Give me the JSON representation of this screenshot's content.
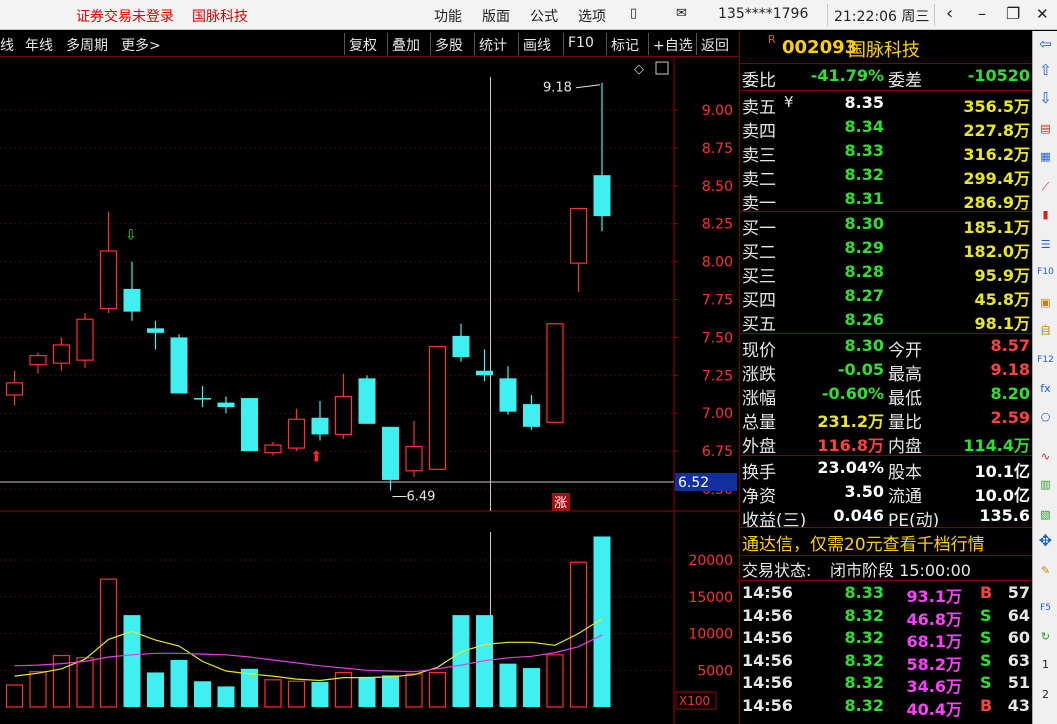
{
  "titlebar": {
    "login_status": "证券交易未登录",
    "stock_name": "国脉科技",
    "menu": [
      "功能",
      "版面",
      "公式",
      "选项"
    ],
    "account": "135****1796",
    "clock": "21:22:06 周三",
    "back_icon": "‹",
    "minimize_icon": "–",
    "restore_icon": "❐",
    "close_icon": "✕"
  },
  "toolbar": {
    "left_items": [
      "线",
      "年线",
      "多周期",
      "更多>"
    ],
    "buttons": [
      "复权",
      "叠加",
      "多股",
      "统计",
      "画线",
      "F10",
      "标记",
      "+自选",
      "返回"
    ]
  },
  "stock": {
    "marker": "R",
    "code": "002093",
    "name": "国脉科技"
  },
  "quote": {
    "weibi_label": "委比",
    "weibi_value": "-41.79%",
    "weicha_label": "委差",
    "weicha_value": "-10520",
    "asks": [
      {
        "label": "卖五",
        "flag": "¥",
        "price": "8.35",
        "volume": "356.5万"
      },
      {
        "label": "卖四",
        "flag": "",
        "price": "8.34",
        "volume": "227.8万"
      },
      {
        "label": "卖三",
        "flag": "",
        "price": "8.33",
        "volume": "316.2万"
      },
      {
        "label": "卖二",
        "flag": "",
        "price": "8.32",
        "volume": "299.4万"
      },
      {
        "label": "卖一",
        "flag": "",
        "price": "8.31",
        "volume": "286.9万"
      }
    ],
    "bids": [
      {
        "label": "买一",
        "price": "8.30",
        "volume": "185.1万"
      },
      {
        "label": "买二",
        "price": "8.29",
        "volume": "182.0万"
      },
      {
        "label": "买三",
        "price": "8.28",
        "volume": "95.9万"
      },
      {
        "label": "买四",
        "price": "8.27",
        "volume": "45.8万"
      },
      {
        "label": "买五",
        "price": "8.26",
        "volume": "98.1万"
      }
    ],
    "stats": [
      {
        "l1": "现价",
        "v1": "8.30",
        "c1": "green",
        "l2": "今开",
        "v2": "8.57",
        "c2": "red"
      },
      {
        "l1": "涨跌",
        "v1": "-0.05",
        "c1": "green",
        "l2": "最高",
        "v2": "9.18",
        "c2": "red"
      },
      {
        "l1": "涨幅",
        "v1": "-0.60%",
        "c1": "green",
        "l2": "最低",
        "v2": "8.20",
        "c2": "green"
      },
      {
        "l1": "总量",
        "v1": "231.2万",
        "c1": "yellow",
        "l2": "量比",
        "v2": "2.59",
        "c2": "red"
      },
      {
        "l1": "外盘",
        "v1": "116.8万",
        "c1": "red",
        "l2": "内盘",
        "v2": "114.4万",
        "c2": "green"
      }
    ],
    "stats2": [
      {
        "l1": "换手",
        "v1": "23.04%",
        "l2": "股本",
        "v2": "10.1亿"
      },
      {
        "l1": "净资",
        "v1": "3.50",
        "l2": "流通",
        "v2": "10.0亿"
      },
      {
        "l1": "收益(三)",
        "v1": "0.046",
        "l2": "PE(动)",
        "v2": "135.6"
      }
    ],
    "ad_text": "通达信，仅需20元查看千档行情",
    "status_label": "交易状态:",
    "status_value": "闭市阶段 15:00:00",
    "ticks": [
      {
        "time": "14:56",
        "price": "8.33",
        "vol": "93.1万",
        "bs": "B",
        "n": "57"
      },
      {
        "time": "14:56",
        "price": "8.32",
        "vol": "46.8万",
        "bs": "S",
        "n": "64"
      },
      {
        "time": "14:56",
        "price": "8.32",
        "vol": "68.1万",
        "bs": "S",
        "n": "60"
      },
      {
        "time": "14:56",
        "price": "8.32",
        "vol": "58.2万",
        "bs": "S",
        "n": "63"
      },
      {
        "time": "14:56",
        "price": "8.32",
        "vol": "34.6万",
        "bs": "S",
        "n": "51"
      },
      {
        "time": "14:56",
        "price": "8.32",
        "vol": "40.4万",
        "bs": "B",
        "n": "43"
      }
    ]
  },
  "chart_data": {
    "type": "candlestick",
    "price_ticks": [
      "9.00",
      "8.75",
      "8.50",
      "8.25",
      "8.00",
      "7.75",
      "7.50",
      "7.25",
      "7.00",
      "6.75",
      "6.50"
    ],
    "volume_ticks": [
      "20000",
      "15000",
      "10000",
      "5000"
    ],
    "volume_unit": "X100",
    "high_label": "9.18",
    "low_label": "6.49",
    "cursor_price": "6.52",
    "limit_up_marker": "涨",
    "candles": [
      {
        "o": 7.12,
        "c": 7.2,
        "h": 7.28,
        "l": 7.05
      },
      {
        "o": 7.32,
        "c": 7.38,
        "h": 7.4,
        "l": 7.26
      },
      {
        "o": 7.33,
        "c": 7.45,
        "h": 7.5,
        "l": 7.28
      },
      {
        "o": 7.35,
        "c": 7.62,
        "h": 7.66,
        "l": 7.3
      },
      {
        "o": 7.69,
        "c": 8.07,
        "h": 8.33,
        "l": 7.66
      },
      {
        "o": 7.82,
        "c": 7.67,
        "h": 8.0,
        "l": 7.61
      },
      {
        "o": 7.56,
        "c": 7.53,
        "h": 7.61,
        "l": 7.42
      },
      {
        "o": 7.5,
        "c": 7.13,
        "h": 7.52,
        "l": 7.13
      },
      {
        "o": 7.1,
        "c": 7.09,
        "h": 7.18,
        "l": 7.04
      },
      {
        "o": 7.07,
        "c": 7.04,
        "h": 7.11,
        "l": 7.0
      },
      {
        "o": 7.1,
        "c": 6.75,
        "h": 7.1,
        "l": 6.75
      },
      {
        "o": 6.74,
        "c": 6.79,
        "h": 6.81,
        "l": 6.72
      },
      {
        "o": 6.77,
        "c": 6.96,
        "h": 7.03,
        "l": 6.75
      },
      {
        "o": 6.97,
        "c": 6.86,
        "h": 7.08,
        "l": 6.82
      },
      {
        "o": 6.86,
        "c": 7.11,
        "h": 7.26,
        "l": 6.83
      },
      {
        "o": 7.23,
        "c": 6.93,
        "h": 7.25,
        "l": 6.93
      },
      {
        "o": 6.91,
        "c": 6.56,
        "h": 6.91,
        "l": 6.49
      },
      {
        "o": 6.62,
        "c": 6.78,
        "h": 6.95,
        "l": 6.58
      },
      {
        "o": 6.63,
        "c": 7.44,
        "h": 7.44,
        "l": 6.63
      },
      {
        "o": 7.51,
        "c": 7.37,
        "h": 7.59,
        "l": 7.34
      },
      {
        "o": 7.28,
        "c": 7.25,
        "h": 7.42,
        "l": 7.21
      },
      {
        "o": 7.23,
        "c": 7.01,
        "h": 7.31,
        "l": 6.99
      },
      {
        "o": 7.06,
        "c": 6.91,
        "h": 7.12,
        "l": 6.89
      },
      {
        "o": 6.94,
        "c": 7.59,
        "h": 7.59,
        "l": 6.94
      },
      {
        "o": 7.99,
        "c": 8.35,
        "h": 8.35,
        "l": 7.8
      },
      {
        "o": 8.57,
        "c": 8.3,
        "h": 9.18,
        "l": 8.2
      }
    ],
    "volumes": [
      3000,
      4800,
      7000,
      6700,
      17400,
      12500,
      4700,
      6400,
      3500,
      2800,
      5200,
      3700,
      3500,
      3400,
      4700,
      4100,
      4300,
      4500,
      4700,
      12500,
      12500,
      5900,
      5300,
      7100,
      19700,
      23200
    ],
    "ma_short": [
      4200,
      4600,
      5200,
      6500,
      9200,
      10300,
      9100,
      8300,
      6200,
      4900,
      4500,
      4200,
      3800,
      3600,
      4000,
      4000,
      4100,
      4400,
      5400,
      7500,
      8500,
      8800,
      8800,
      8400,
      10000,
      12000
    ],
    "ma_long": [
      5600,
      5700,
      5900,
      6200,
      6800,
      7100,
      7300,
      7300,
      7200,
      7100,
      6800,
      6400,
      6000,
      5600,
      5300,
      5000,
      4900,
      4800,
      5200,
      5700,
      6300,
      6700,
      6900,
      7400,
      8200,
      9800
    ]
  }
}
